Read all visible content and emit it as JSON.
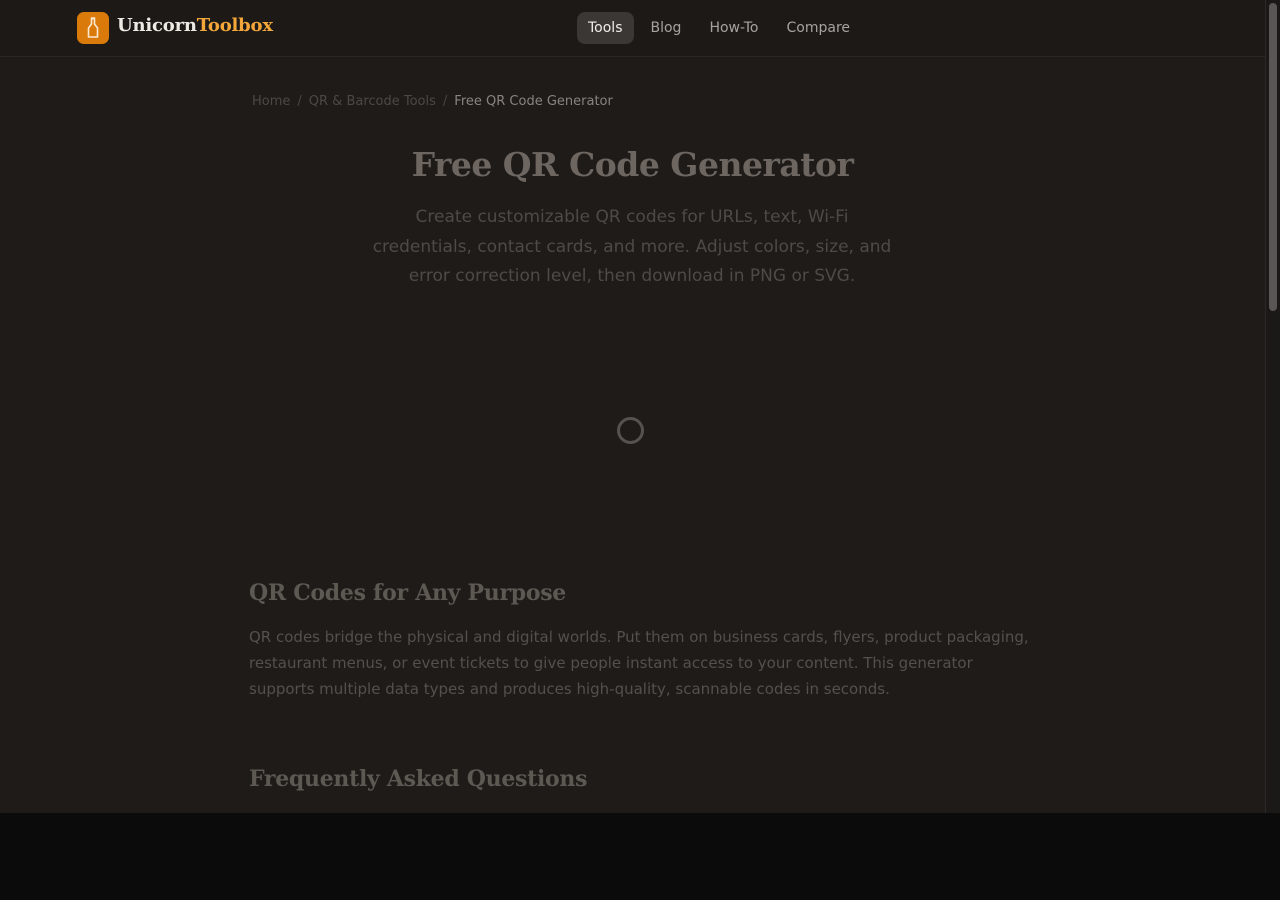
{
  "brand": {
    "name_part1": "Unicorn",
    "name_part2": "Toolbox",
    "accent": "#f3a63a",
    "badge_color": "#d97a0b",
    "icon": "bottle-icon"
  },
  "nav": {
    "items": [
      {
        "label": "Tools",
        "active": true
      },
      {
        "label": "Blog",
        "active": false
      },
      {
        "label": "How-To",
        "active": false
      },
      {
        "label": "Compare",
        "active": false
      }
    ]
  },
  "breadcrumb": {
    "items": [
      "Home",
      "QR & Barcode Tools",
      "Free QR Code Generator"
    ],
    "separator": "/"
  },
  "hero": {
    "title": "Free QR Code Generator",
    "subtitle": "Create customizable QR codes for URLs, text, Wi-Fi credentials, contact cards, and more. Adjust colors, size, and error correction level, then download in PNG or SVG."
  },
  "loading": {
    "icon": "loading-spinner-icon"
  },
  "sections": [
    {
      "title": "QR Codes for Any Purpose",
      "body": "QR codes bridge the physical and digital worlds. Put them on business cards, flyers, product packaging, restaurant menus, or event tickets to give people instant access to your content. This generator supports multiple data types and produces high-quality, scannable codes in seconds."
    },
    {
      "title": "Frequently Asked Questions"
    }
  ]
}
